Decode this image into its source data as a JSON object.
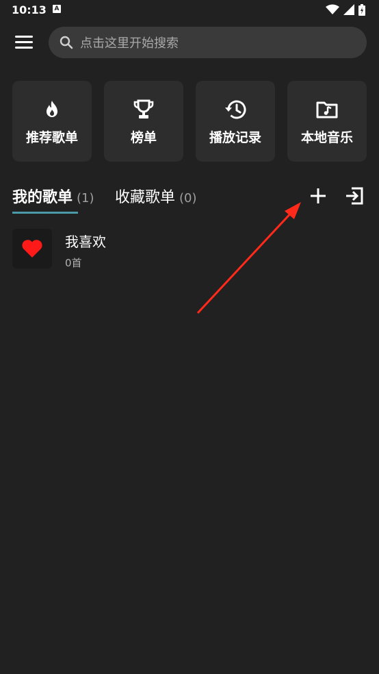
{
  "status_bar": {
    "time": "10:13",
    "notification_badge": "A"
  },
  "search": {
    "placeholder": "点击这里开始搜索"
  },
  "quick_cards": [
    {
      "label": "推荐歌单",
      "icon": "flame-icon"
    },
    {
      "label": "榜单",
      "icon": "trophy-icon"
    },
    {
      "label": "播放记录",
      "icon": "history-icon"
    },
    {
      "label": "本地音乐",
      "icon": "music-folder-icon"
    }
  ],
  "tabs": [
    {
      "label": "我的歌单",
      "count": "(1)",
      "active": true
    },
    {
      "label": "收藏歌单",
      "count": "(0)",
      "active": false
    }
  ],
  "actions": {
    "add_icon": "plus-icon",
    "import_icon": "import-icon"
  },
  "playlists": [
    {
      "name": "我喜欢",
      "count": "0首",
      "icon": "heart-icon"
    }
  ],
  "colors": {
    "background": "#212121",
    "card": "#2d2d2d",
    "accent": "#4a9aa8",
    "annotation_arrow": "#ff2a1a",
    "heart": "#ff1a1a"
  }
}
